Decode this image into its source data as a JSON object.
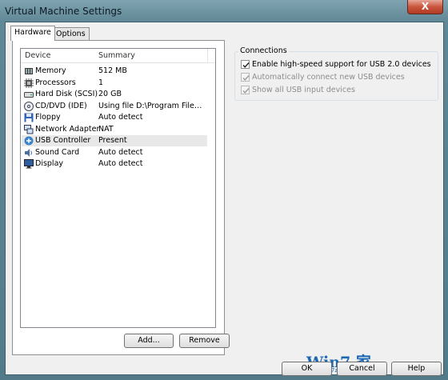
{
  "window": {
    "title": "Virtual Machine Settings",
    "close_glyph": "X"
  },
  "tabs": [
    {
      "label": "Hardware",
      "active": true
    },
    {
      "label": "Options",
      "active": false
    }
  ],
  "device_list": {
    "columns": [
      "Device",
      "Summary"
    ],
    "rows": [
      {
        "device": "Memory",
        "summary": "512 MB",
        "icon": "memory-icon"
      },
      {
        "device": "Processors",
        "summary": "1",
        "icon": "processor-icon"
      },
      {
        "device": "Hard Disk (SCSI)",
        "summary": "20 GB",
        "icon": "hard-disk-icon"
      },
      {
        "device": "CD/DVD (IDE)",
        "summary": "Using file D:\\Program Files\\v...",
        "icon": "cd-dvd-icon"
      },
      {
        "device": "Floppy",
        "summary": "Auto detect",
        "icon": "floppy-icon"
      },
      {
        "device": "Network Adapter",
        "summary": "NAT",
        "icon": "network-adapter-icon"
      },
      {
        "device": "USB Controller",
        "summary": "Present",
        "icon": "usb-controller-icon",
        "selected": true
      },
      {
        "device": "Sound Card",
        "summary": "Auto detect",
        "icon": "sound-card-icon"
      },
      {
        "device": "Display",
        "summary": "Auto detect",
        "icon": "display-icon"
      }
    ]
  },
  "list_buttons": {
    "add": "Add...",
    "remove": "Remove"
  },
  "connections": {
    "title": "Connections",
    "options": [
      {
        "label": "Enable high-speed support for USB 2.0 devices",
        "checked": true,
        "enabled": true
      },
      {
        "label": "Automatically connect new USB devices",
        "checked": true,
        "enabled": false
      },
      {
        "label": "Show all USB input devices",
        "checked": true,
        "enabled": false
      }
    ]
  },
  "dialog_buttons": {
    "ok": "OK",
    "cancel": "Cancel",
    "help": "Help"
  },
  "watermark": {
    "main": "Win7.家",
    "sub": "www.win7zhijia.cn"
  },
  "colors": {
    "title_bar": "#5f8795",
    "selection": "#e8e8e8",
    "watermark": "#1b67b3"
  }
}
